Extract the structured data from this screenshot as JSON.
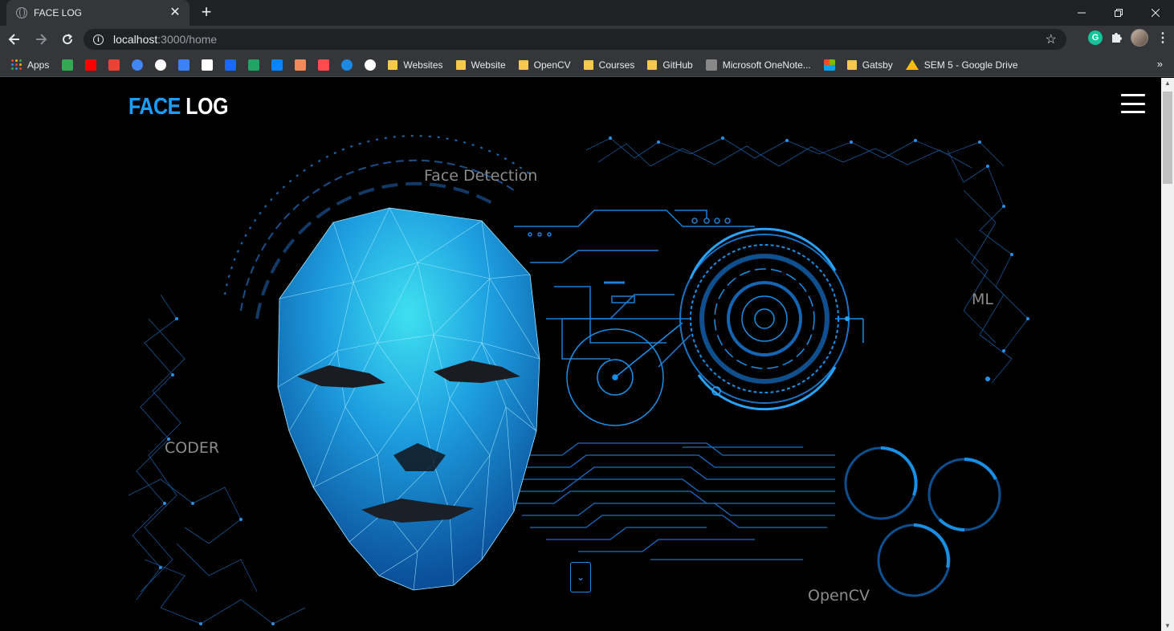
{
  "browser": {
    "tab_title": "FACE LOG",
    "tab_close": "✕",
    "new_tab": "+",
    "url_host": "localhost",
    "url_path": ":3000/home",
    "grammarly": "G",
    "bookmarks": [
      {
        "label": "Apps",
        "icon": "apps-grid-icon"
      },
      {
        "label": "",
        "icon": "maps-icon",
        "color": "#34a853"
      },
      {
        "label": "",
        "icon": "youtube-icon",
        "color": "#ff0000"
      },
      {
        "label": "",
        "icon": "gmail-icon",
        "color": "#ea4335"
      },
      {
        "label": "",
        "icon": "google-icon",
        "color": "#4285f4"
      },
      {
        "label": "",
        "icon": "github-icon",
        "color": "#ffffff"
      },
      {
        "label": "",
        "icon": "bookmark-icon",
        "color": "#3b82f6"
      },
      {
        "label": "",
        "icon": "p-icon",
        "color": "#ffffff"
      },
      {
        "label": "",
        "icon": "behance-icon",
        "color": "#1769ff"
      },
      {
        "label": "",
        "icon": "green-icon",
        "color": "#21a366"
      },
      {
        "label": "",
        "icon": "onedrive-icon",
        "color": "#0a84ff"
      },
      {
        "label": "",
        "icon": "box-icon",
        "color": "#f08a5d"
      },
      {
        "label": "",
        "icon": "u-icon",
        "color": "#ff4b4b"
      },
      {
        "label": "",
        "icon": "play-icon",
        "color": "#1e88e5"
      },
      {
        "label": "",
        "icon": "globe-icon",
        "color": "#ffffff"
      },
      {
        "label": "Websites",
        "icon": "folder-icon"
      },
      {
        "label": "Website",
        "icon": "folder-icon"
      },
      {
        "label": "OpenCV",
        "icon": "folder-icon"
      },
      {
        "label": "Courses",
        "icon": "folder-icon"
      },
      {
        "label": "GitHub",
        "icon": "folder-icon"
      },
      {
        "label": "Microsoft OneNote...",
        "icon": "youtube-icon"
      },
      {
        "label": "",
        "icon": "microsoft-icon"
      },
      {
        "label": "Gatsby",
        "icon": "folder-icon"
      },
      {
        "label": "SEM 5 - Google Drive",
        "icon": "drive-icon"
      }
    ],
    "more_bookmarks": "»"
  },
  "page": {
    "brand_primary": "FACE",
    "brand_secondary": "LOG",
    "brand_primary_color": "#1a9fff",
    "menu_icon": "hamburger-menu-icon",
    "words": {
      "face_detection": "Face Detection",
      "ml": "ML",
      "coder": "CODER",
      "opencv": "OpenCV"
    },
    "scroll_button_icon": "⌄"
  }
}
